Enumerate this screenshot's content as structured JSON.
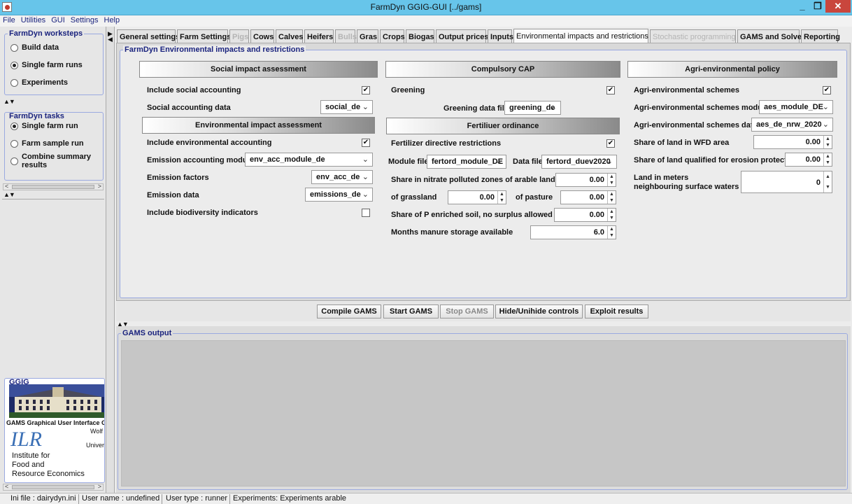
{
  "window": {
    "title": "FarmDyn GGIG-GUI [../gams]",
    "minimize": "_",
    "maximize": "❐",
    "close": "✕"
  },
  "menu": [
    "File",
    "Utilities",
    "GUI",
    "Settings",
    "Help"
  ],
  "worksteps": {
    "legend": "FarmDyn worksteps",
    "items": [
      {
        "label": "Build data",
        "selected": false
      },
      {
        "label": "Single farm runs",
        "selected": true
      },
      {
        "label": "Experiments",
        "selected": false
      }
    ]
  },
  "tasks": {
    "legend": "FarmDyn tasks",
    "items": [
      {
        "label": "Single farm run",
        "selected": true
      },
      {
        "label": "Farm sample run",
        "selected": false
      },
      {
        "label": "Combine summary results",
        "selected": false
      }
    ]
  },
  "ggig": {
    "legend": "GGIG",
    "caption": "GAMS Graphical User Interface Generator",
    "author_fragment": "Wolf",
    "univ_fragment": "Univer",
    "ilr": "ILR",
    "inst_lines": [
      "Institute  for",
      "Food and",
      "Resource Economics"
    ]
  },
  "tabs": [
    {
      "label": "General settings",
      "state": "normal"
    },
    {
      "label": "Farm Settings",
      "state": "normal"
    },
    {
      "label": "Pigs",
      "state": "disabled"
    },
    {
      "label": "Cows",
      "state": "normal"
    },
    {
      "label": "Calves",
      "state": "normal"
    },
    {
      "label": "Heifers",
      "state": "normal"
    },
    {
      "label": "Bulls",
      "state": "disabled"
    },
    {
      "label": "Gras",
      "state": "normal"
    },
    {
      "label": "Crops",
      "state": "normal"
    },
    {
      "label": "Biogas",
      "state": "normal"
    },
    {
      "label": "Output prices",
      "state": "normal"
    },
    {
      "label": "Inputs",
      "state": "normal"
    },
    {
      "label": "Environmental impacts and restrictions",
      "state": "active"
    },
    {
      "label": "Stochastic programming",
      "state": "disabled"
    },
    {
      "label": "GAMS and Solver",
      "state": "normal"
    },
    {
      "label": "Reporting",
      "state": "normal"
    }
  ],
  "main_legend": "FarmDyn Environmental impacts and restrictions",
  "social": {
    "header": "Social impact assessment",
    "include_label": "Include social accounting",
    "include_checked": true,
    "data_label": "Social accounting data",
    "data_value": "social_de"
  },
  "env": {
    "header": "Environmental impact assessment",
    "include_label": "Include environmental accounting",
    "include_checked": true,
    "module_label": "Emission accounting module",
    "module_value": "env_acc_module_de",
    "factors_label": "Emission factors",
    "factors_value": "env_acc_de",
    "data_label": "Emission data",
    "data_value": "emissions_de",
    "bio_label": "Include biodiversity indicators",
    "bio_checked": false
  },
  "cap": {
    "header": "Compulsory CAP",
    "greening_label": "Greening",
    "greening_checked": true,
    "data_label": "Greening data file",
    "data_value": "greening_de"
  },
  "fert": {
    "header": "Fertiliuer ordinance",
    "restrictions_label": "Fertilizer directive restrictions",
    "restrictions_checked": true,
    "module_label": "Module file",
    "module_value": "fertord_module_DE",
    "data_label": "Data file",
    "data_value": "fertord_duev2020",
    "nitrate_label": "Share in nitrate polluted zones of arable land",
    "nitrate_value": "0.00",
    "grassland_label": "of grassland",
    "grassland_value": "0.00",
    "pasture_label": "of pasture",
    "pasture_value": "0.00",
    "p_label": "Share of P enriched soil, no surplus allowed",
    "p_value": "0.00",
    "manure_label": "Months manure storage available",
    "manure_value": "6.0"
  },
  "agri": {
    "header": "Agri-environmental policy",
    "schemes_label": "Agri-environmental schemes",
    "schemes_checked": true,
    "module_label": "Agri-environmental schemes module",
    "module_value": "aes_module_DE",
    "data_label": "Agri-environmental schemes data",
    "data_value": "aes_de_nrw_2020",
    "wfd_label": "Share of land in WFD area",
    "wfd_value": "0.00",
    "erosion_label": "Share of land qualified for erosion protection",
    "erosion_value": "0.00",
    "meters_label_1": "Land in meters",
    "meters_label_2": "neighbouring surface waters",
    "meters_value": "0"
  },
  "buttons": {
    "compile": "Compile GAMS",
    "start": "Start GAMS",
    "stop": "Stop GAMS",
    "hide": "Hide/Unihide controls",
    "exploit": "Exploit results"
  },
  "output_legend": "GAMS output",
  "status": {
    "ini": "Ini file : dairydyn.ini",
    "user": "User name : undefined",
    "type": "User type : runner",
    "exp": "Experiments: Experiments arable"
  }
}
